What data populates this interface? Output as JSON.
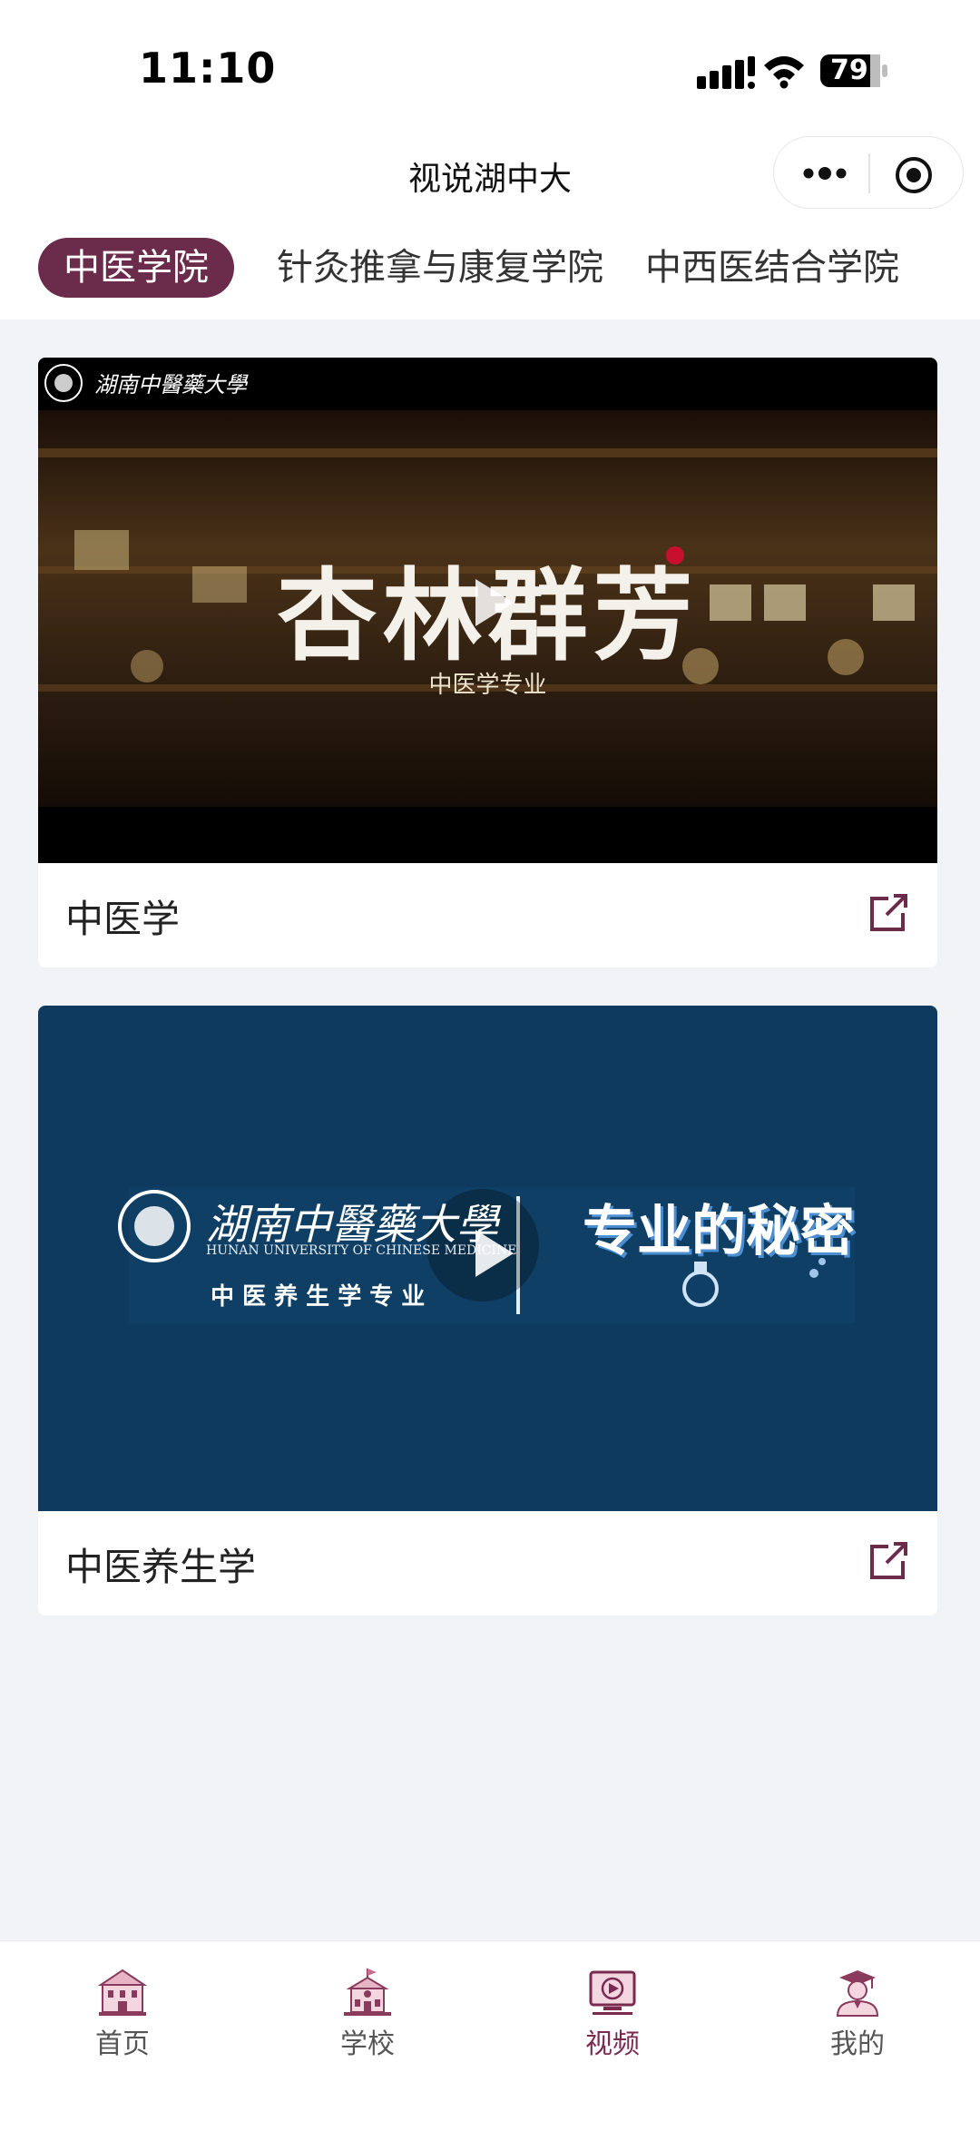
{
  "status_bar": {
    "time": "11:10",
    "battery": "79"
  },
  "nav": {
    "title": "视说湖中大"
  },
  "tabs": [
    {
      "label": "中医学院"
    },
    {
      "label": "针灸推拿与康复学院"
    },
    {
      "label": "中西医结合学院"
    }
  ],
  "videos": [
    {
      "title": "中医学",
      "thumb": {
        "logo_text": "湖南中醫藥大學",
        "calligraphy": "杏林群芳",
        "subtitle": "中医学专业"
      }
    },
    {
      "title": "中医养生学",
      "thumb": {
        "logo_text": "湖南中醫藥大學",
        "logo_english": "HUNAN UNIVERSITY OF CHINESE MEDICINE",
        "major": "中 医 养 生 学 专 业",
        "series": "专业的秘密"
      }
    }
  ],
  "tabbar": [
    {
      "label": "首页",
      "icon": "home-building-icon"
    },
    {
      "label": "学校",
      "icon": "school-icon"
    },
    {
      "label": "视频",
      "icon": "video-icon",
      "active": true
    },
    {
      "label": "我的",
      "icon": "graduate-profile-icon"
    }
  ],
  "colors": {
    "accent": "#6b2b4b",
    "thumb2_bg": "#0d3a5e"
  }
}
